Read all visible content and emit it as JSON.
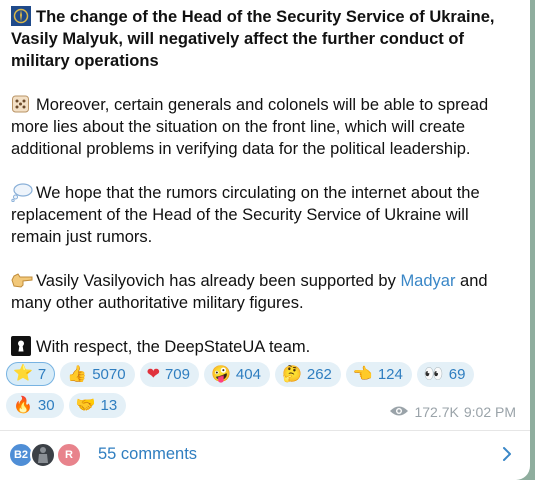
{
  "post": {
    "title": "The change of the Head of the Security Service of Ukraine, Vasily Malyuk, will negatively affect the further conduct of military operations",
    "para1": "Moreover, certain generals and colonels will be able to spread more lies about the situation on the front line, which will create additional problems in verifying data for the political leadership.",
    "para2": "We hope that the rumors circulating on the internet about the replacement of the Head of the Security Service of Ukraine will remain just rumors.",
    "para3_before": "Vasily Vasilyovich has already been supported by ",
    "para3_link": "Madyar",
    "para3_after": " and many other authoritative military figures.",
    "para4": "With respect, the DeepStateUA team."
  },
  "reactions": [
    {
      "icon": "star-icon",
      "glyph": "⭐",
      "count": "7",
      "active": true
    },
    {
      "icon": "thumbs-up-icon",
      "glyph": "👍",
      "count": "5070"
    },
    {
      "icon": "heart-icon",
      "glyph": "❤",
      "count": "709"
    },
    {
      "icon": "zany-face-icon",
      "glyph": "🤪",
      "count": "404"
    },
    {
      "icon": "thinking-face-icon",
      "glyph": "🤔",
      "count": "262"
    },
    {
      "icon": "pointing-hand-icon",
      "glyph": "👈",
      "count": "124"
    },
    {
      "icon": "eyes-icon",
      "glyph": "👀",
      "count": "69"
    },
    {
      "icon": "fire-icon",
      "glyph": "🔥",
      "count": "30"
    },
    {
      "icon": "handshake-icon",
      "glyph": "🤝",
      "count": "13"
    }
  ],
  "meta": {
    "views": "172.7K",
    "time": "9:02 PM"
  },
  "comments": {
    "label": "55 comments",
    "avatars": [
      {
        "initials": "B2",
        "color": "#4f8ed6"
      },
      {
        "initials": "",
        "color": "#3b4046"
      },
      {
        "initials": "R",
        "color": "#e8838c"
      }
    ]
  },
  "colors": {
    "link": "#3a87c7",
    "accent": "#2f7ec0",
    "reaction_bg": "#e4f0f7"
  }
}
